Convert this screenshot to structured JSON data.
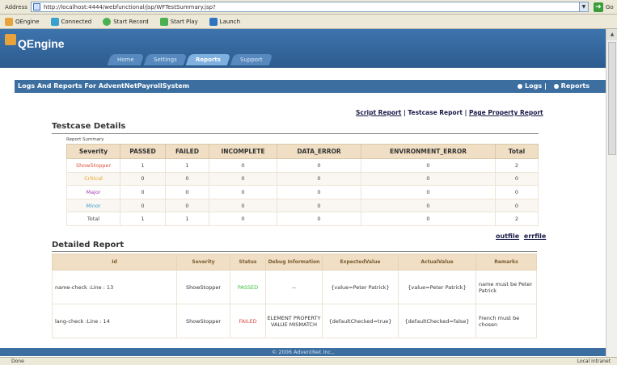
{
  "browser": {
    "address_label": "Address",
    "url": "http://localhost:4444/webfunctional/jsp/WFTestSummary.jsp?",
    "go_label": "Go",
    "toolbar": [
      "QEngine",
      "Connected",
      "Start Record",
      "Start Play",
      "Launch"
    ],
    "status": "Done",
    "zone": "Local intranet"
  },
  "app": {
    "logo": "QEngine",
    "tabs": [
      "Home",
      "Settings",
      "Reports",
      "Support"
    ],
    "active_tab": "Reports"
  },
  "panel": {
    "title": "Logs And Reports For AdventNetPayrollSystem",
    "logs_link": "Logs",
    "reports_link": "Reports",
    "separator": "|"
  },
  "report_links": {
    "script": "Script Report",
    "testcase": "Testcase Report",
    "page_property": "Page Property Report",
    "sep": "|"
  },
  "testcase_details": {
    "title": "Testcase Details",
    "summary_label": "Report Summary",
    "columns": [
      "Severity",
      "PASSED",
      "FAILED",
      "INCOMPLETE",
      "DATA_ERROR",
      "ENVIRONMENT_ERROR",
      "Total"
    ],
    "rows": [
      {
        "severity": "ShowStopper",
        "passed": "1",
        "failed": "1",
        "incomplete": "0",
        "data_error": "0",
        "env_error": "0",
        "total": "2"
      },
      {
        "severity": "Critical",
        "passed": "0",
        "failed": "0",
        "incomplete": "0",
        "data_error": "0",
        "env_error": "0",
        "total": "0"
      },
      {
        "severity": "Major",
        "passed": "0",
        "failed": "0",
        "incomplete": "0",
        "data_error": "0",
        "env_error": "0",
        "total": "0"
      },
      {
        "severity": "Minor",
        "passed": "0",
        "failed": "0",
        "incomplete": "0",
        "data_error": "0",
        "env_error": "0",
        "total": "0"
      },
      {
        "severity": "Total",
        "passed": "1",
        "failed": "1",
        "incomplete": "0",
        "data_error": "0",
        "env_error": "0",
        "total": "2"
      }
    ],
    "severity_colors": {
      "ShowStopper": "#e0503c",
      "Critical": "#e8a020",
      "Major": "#a040b0",
      "Minor": "#3aa0d0",
      "Total": "#444444"
    }
  },
  "out_links": {
    "outfile": "outfile",
    "errfile": "errfile"
  },
  "detailed_report": {
    "title": "Detailed Report",
    "columns": [
      "Id",
      "Severity",
      "Status",
      "Debug Information",
      "ExpectedValue",
      "ActualValue",
      "Remarks"
    ],
    "rows": [
      {
        "id": "name-check :Line : 13",
        "severity": "ShowStopper",
        "status": "PASSED",
        "debug": "--",
        "expected": "{value=Peter Patrick}",
        "actual": "{value=Peter Patrick}",
        "remarks": "name must be Peter Patrick"
      },
      {
        "id": "lang-check :Line : 14",
        "severity": "ShowStopper",
        "status": "FAILED",
        "debug": "ELEMENT PROPERTY VALUE MISMATCH",
        "expected": "{defaultChecked=true}",
        "actual": "{defaultChecked=false}",
        "remarks": "French must be chosen"
      }
    ],
    "status_colors": {
      "PASSED": "#3cc03c",
      "FAILED": "#e04a3a"
    }
  },
  "footer": "© 2006 AdventNet Inc.,"
}
